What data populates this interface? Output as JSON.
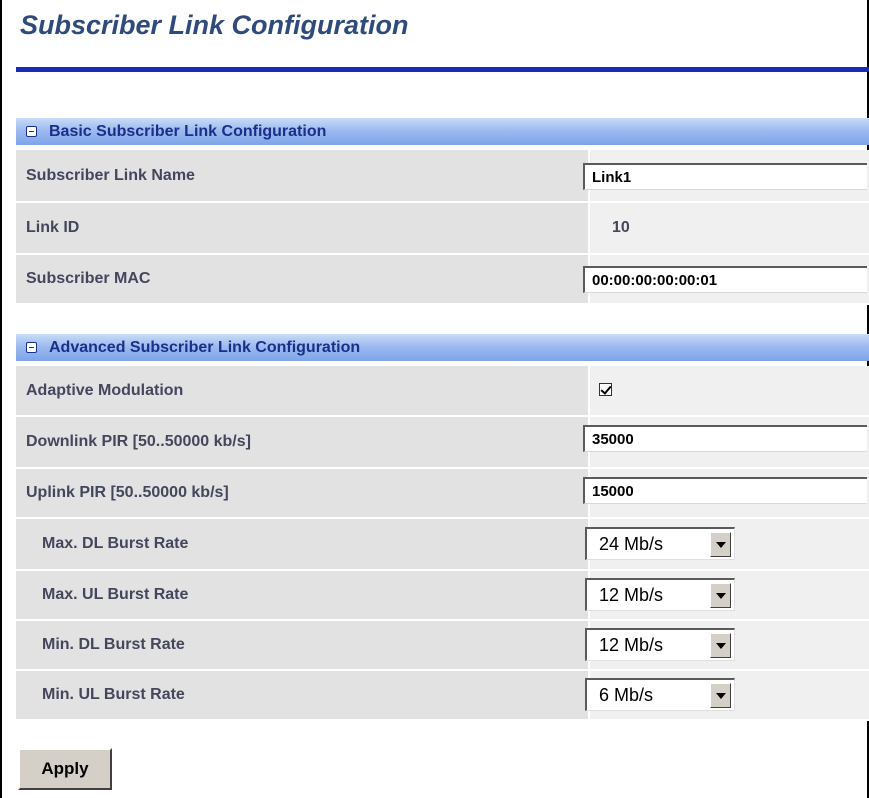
{
  "page": {
    "title": "Subscriber Link Configuration"
  },
  "basic_section": {
    "title": "Basic Subscriber Link Configuration",
    "subscriber_link_name": {
      "label": "Subscriber Link Name",
      "value": "Link1"
    },
    "link_id": {
      "label": "Link ID",
      "value": "10"
    },
    "subscriber_mac": {
      "label": "Subscriber MAC",
      "value": "00:00:00:00:00:01"
    }
  },
  "advanced_section": {
    "title": "Advanced Subscriber Link Configuration",
    "adaptive_modulation": {
      "label": "Adaptive Modulation",
      "checked": true
    },
    "downlink_pir": {
      "label": "Downlink PIR [50..50000 kb/s]",
      "value": "35000"
    },
    "uplink_pir": {
      "label": "Uplink PIR [50..50000 kb/s]",
      "value": "15000"
    },
    "max_dl_burst": {
      "label": "Max. DL Burst Rate",
      "value": "24 Mb/s"
    },
    "max_ul_burst": {
      "label": "Max. UL Burst Rate",
      "value": "12 Mb/s"
    },
    "min_dl_burst": {
      "label": "Min. DL Burst Rate",
      "value": "12 Mb/s"
    },
    "min_ul_burst": {
      "label": "Min. UL Burst Rate",
      "value": "6 Mb/s"
    }
  },
  "actions": {
    "apply_label": "Apply"
  },
  "icons": {
    "section_toggle": "collapse-minus-icon",
    "select_arrow": "chevron-down-icon"
  },
  "colors": {
    "title_text": "#2f4b7c",
    "title_rule": "#1a2ab8",
    "section_header_bg": "#9dbbf0",
    "section_header_text": "#1b2f8a",
    "label_cell_bg": "#e2e2e2",
    "label_text": "#44475c",
    "button_face": "#d4d0c8"
  }
}
